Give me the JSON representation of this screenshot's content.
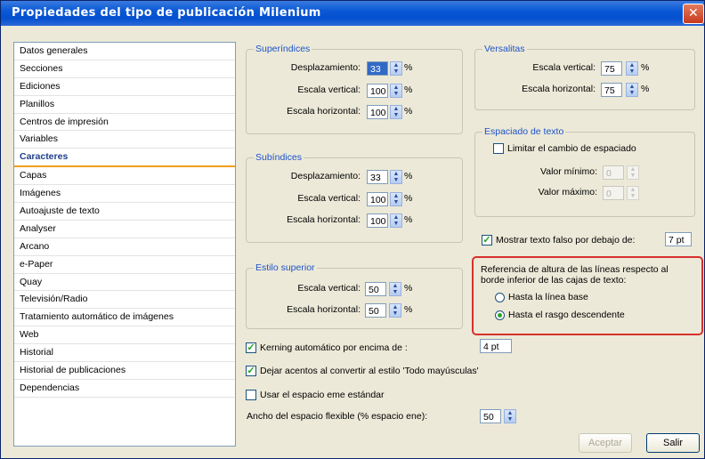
{
  "window": {
    "title": "Propiedades del tipo de publicación Milenium",
    "close_glyph": "✕"
  },
  "nav": {
    "items": [
      {
        "label": "Datos generales"
      },
      {
        "label": "Secciones"
      },
      {
        "label": "Ediciones"
      },
      {
        "label": "Planillos"
      },
      {
        "label": "Centros de impresión"
      },
      {
        "label": "Variables"
      },
      {
        "label": "Caracteres",
        "selected": true
      },
      {
        "label": "Capas"
      },
      {
        "label": "Imágenes"
      },
      {
        "label": "Autoajuste de texto"
      },
      {
        "label": "Analyser"
      },
      {
        "label": "Arcano"
      },
      {
        "label": "e-Paper"
      },
      {
        "label": "Quay"
      },
      {
        "label": "Televisión/Radio"
      },
      {
        "label": "Tratamiento automático de imágenes"
      },
      {
        "label": "Web"
      },
      {
        "label": "Historial"
      },
      {
        "label": "Historial de publicaciones"
      },
      {
        "label": "Dependencias"
      }
    ]
  },
  "superindices": {
    "title": "Superíndices",
    "desplazamiento": {
      "label": "Desplazamiento:",
      "value": "33",
      "unit": "%"
    },
    "escala_vertical": {
      "label": "Escala vertical:",
      "value": "100",
      "unit": "%"
    },
    "escala_horizontal": {
      "label": "Escala horizontal:",
      "value": "100",
      "unit": "%"
    }
  },
  "subindices": {
    "title": "Subíndices",
    "desplazamiento": {
      "label": "Desplazamiento:",
      "value": "33",
      "unit": "%"
    },
    "escala_vertical": {
      "label": "Escala vertical:",
      "value": "100",
      "unit": "%"
    },
    "escala_horizontal": {
      "label": "Escala horizontal:",
      "value": "100",
      "unit": "%"
    }
  },
  "estilo_superior": {
    "title": "Estilo superior",
    "escala_vertical": {
      "label": "Escala vertical:",
      "value": "50",
      "unit": "%"
    },
    "escala_horizontal": {
      "label": "Escala horizontal:",
      "value": "50",
      "unit": "%"
    }
  },
  "versalitas": {
    "title": "Versalitas",
    "escala_vertical": {
      "label": "Escala vertical:",
      "value": "75",
      "unit": "%"
    },
    "escala_horizontal": {
      "label": "Escala horizontal:",
      "value": "75",
      "unit": "%"
    }
  },
  "espaciado": {
    "title": "Espaciado de texto",
    "limitar": {
      "label": "Limitar el cambio de espaciado",
      "checked": false
    },
    "valor_minimo": {
      "label": "Valor mínimo:",
      "value": "0"
    },
    "valor_maximo": {
      "label": "Valor máximo:",
      "value": "0"
    }
  },
  "mostrar_texto_falso": {
    "label": "Mostrar texto falso por debajo de:",
    "checked": true,
    "value": "7 pt"
  },
  "referencia": {
    "text": "Referencia de altura de las líneas respecto al borde inferior de las cajas de texto:",
    "options": [
      {
        "label": "Hasta la línea base",
        "selected": false
      },
      {
        "label": "Hasta el rasgo descendente",
        "selected": true
      }
    ]
  },
  "kerning": {
    "label": "Kerning automático por encima de :",
    "checked": true,
    "value": "4 pt"
  },
  "acentos": {
    "label": "Dejar acentos al convertir al estilo  'Todo mayúsculas'",
    "checked": true
  },
  "espacio_eme": {
    "label": "Usar el espacio eme estándar",
    "checked": false
  },
  "ancho_flexible": {
    "label": "Ancho del espacio flexible (% espacio ene):",
    "value": "50"
  },
  "buttons": {
    "aceptar": "Aceptar",
    "salir": "Salir"
  },
  "colors": {
    "group_title": "#1c52c8",
    "highlight": "#d8302c",
    "titlebar": "#0450cf"
  }
}
